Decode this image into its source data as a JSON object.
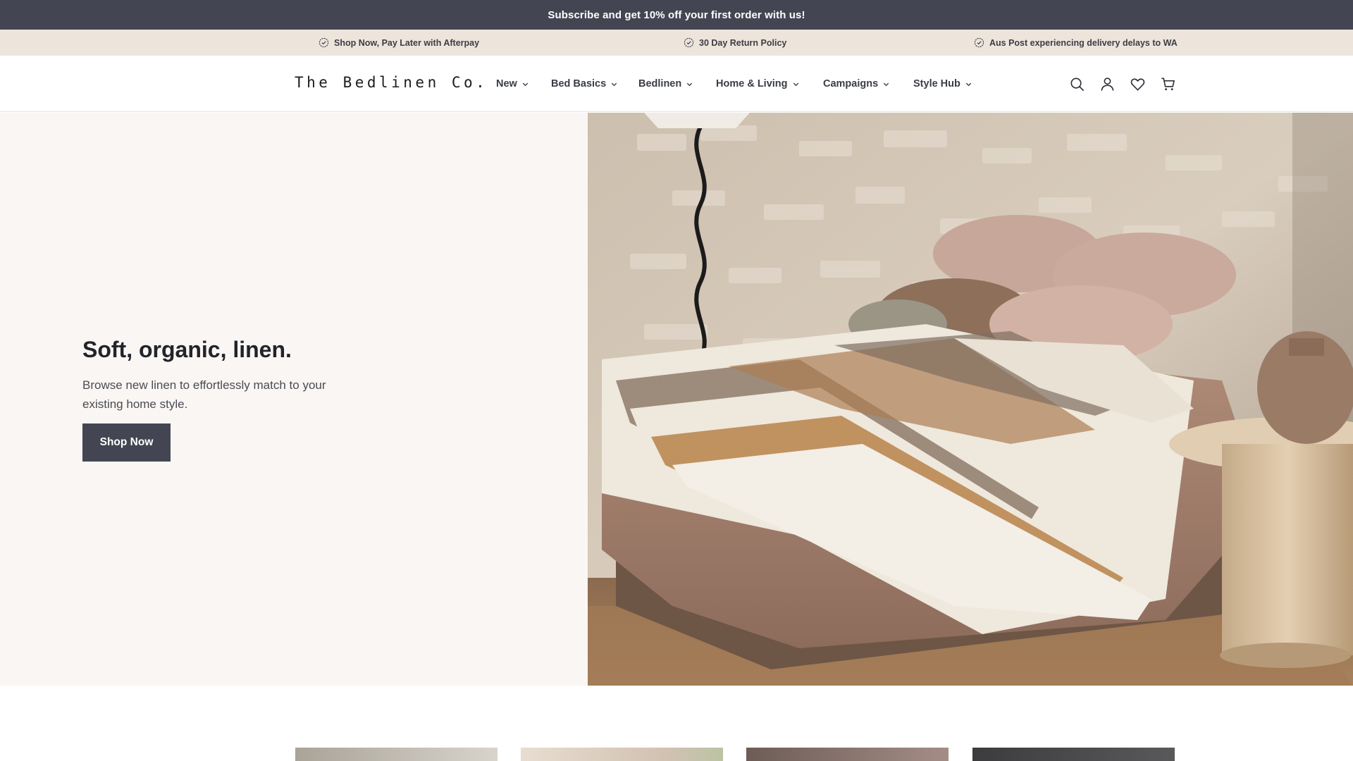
{
  "promo": {
    "text": "Subscribe and get 10% off your first order with us!"
  },
  "usp": [
    {
      "text": "Shop Now, Pay Later with Afterpay",
      "icon": "badge-check-icon"
    },
    {
      "text": "30 Day Return Policy",
      "icon": "badge-check-icon"
    },
    {
      "text": "Aus Post experiencing delivery delays to WA",
      "icon": "badge-check-icon"
    }
  ],
  "header": {
    "logo": "The Bedlinen Co.",
    "nav": [
      {
        "label": "New"
      },
      {
        "label": "Bed Basics"
      },
      {
        "label": "Bedlinen"
      },
      {
        "label": "Home & Living"
      },
      {
        "label": "Campaigns"
      },
      {
        "label": "Style Hub"
      }
    ],
    "icons": [
      "search-icon",
      "account-icon",
      "wishlist-heart-icon",
      "cart-icon"
    ]
  },
  "hero": {
    "title": "Soft, organic, linen.",
    "subtitle": "Browse new linen to effortlessly match to your existing home style.",
    "cta": "Shop Now",
    "image": "bedroom-linen-photo"
  },
  "colors": {
    "promo_bg": "#434652",
    "usp_bg": "#ede4dc",
    "hero_left_bg": "#faf6f3",
    "button_bg": "#434652",
    "text_dark": "#22242a"
  },
  "category_cards": [
    {
      "image": "category-image-1"
    },
    {
      "image": "category-image-2"
    },
    {
      "image": "category-image-3"
    },
    {
      "image": "category-image-4"
    }
  ]
}
